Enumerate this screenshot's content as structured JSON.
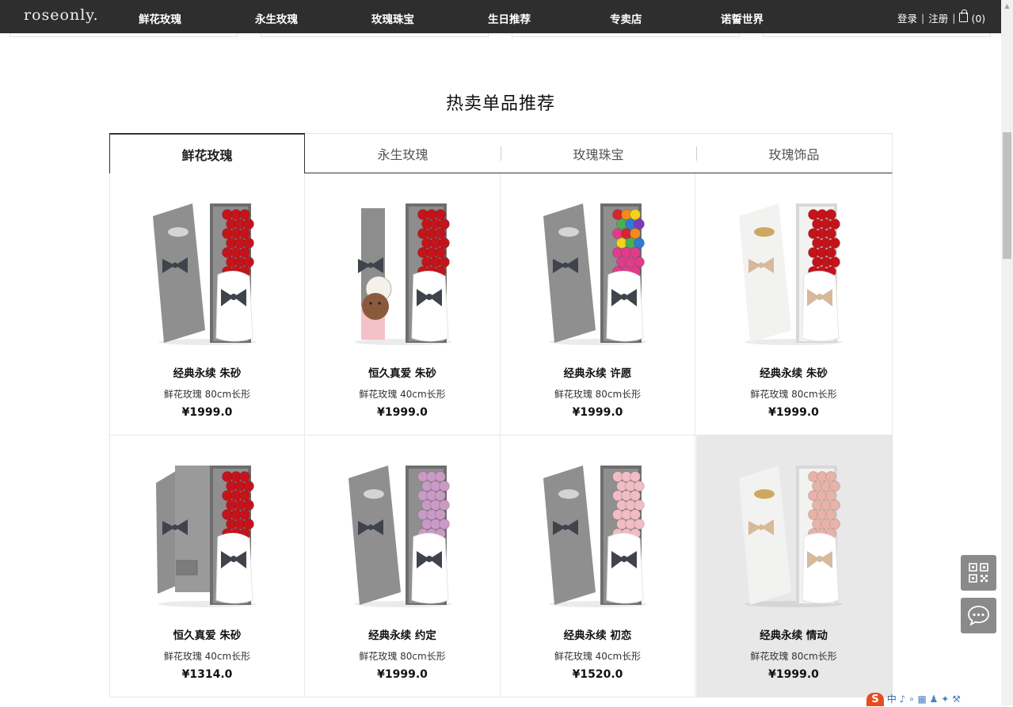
{
  "header": {
    "logo": "roseonly.",
    "nav": [
      "鲜花玫瑰",
      "永生玫瑰",
      "玫瑰珠宝",
      "生日推荐",
      "专卖店",
      "诺誓世界"
    ],
    "login": "登录",
    "register": "注册",
    "cart_count": "(0)"
  },
  "section": {
    "title": "热卖单品推荐",
    "tabs": [
      "鲜花玫瑰",
      "永生玫瑰",
      "玫瑰珠宝",
      "玫瑰饰品"
    ],
    "active_tab": 0
  },
  "products": [
    {
      "name": "经典永续 朱砂",
      "spec": "鲜花玫瑰 80cm长形",
      "price": "¥1999.0",
      "rose_color": "#c4141b",
      "box": "gray",
      "rainbow": false
    },
    {
      "name": "恒久真爱 朱砂",
      "spec": "鲜花玫瑰 40cm长形",
      "price": "¥1999.0",
      "rose_color": "#c4141b",
      "box": "bear",
      "rainbow": false
    },
    {
      "name": "经典永续 许愿",
      "spec": "鲜花玫瑰 80cm长形",
      "price": "¥1999.0",
      "rose_color": "#e03c8a",
      "box": "gray",
      "rainbow": true
    },
    {
      "name": "经典永续 朱砂",
      "spec": "鲜花玫瑰 80cm长形",
      "price": "¥1999.0",
      "rose_color": "#c4141b",
      "box": "white",
      "rainbow": false
    },
    {
      "name": "恒久真爱 朱砂",
      "spec": "鲜花玫瑰 40cm长形",
      "price": "¥1314.0",
      "rose_color": "#c4141b",
      "box": "gray-open",
      "rainbow": false
    },
    {
      "name": "经典永续 约定",
      "spec": "鲜花玫瑰 80cm长形",
      "price": "¥1999.0",
      "rose_color": "#c99ac6",
      "box": "gray",
      "rainbow": false
    },
    {
      "name": "经典永续 初恋",
      "spec": "鲜花玫瑰 40cm长形",
      "price": "¥1520.0",
      "rose_color": "#f1bcc4",
      "box": "gray",
      "rainbow": false
    },
    {
      "name": "经典永续 情动",
      "spec": "鲜花玫瑰 80cm长形",
      "price": "¥1999.0",
      "rose_color": "#e7b2a7",
      "box": "white",
      "rainbow": false
    }
  ],
  "hovered_product": 7,
  "float_buttons": [
    "qrcode-icon",
    "chat-icon"
  ],
  "ime_bar": {
    "label": "中"
  }
}
